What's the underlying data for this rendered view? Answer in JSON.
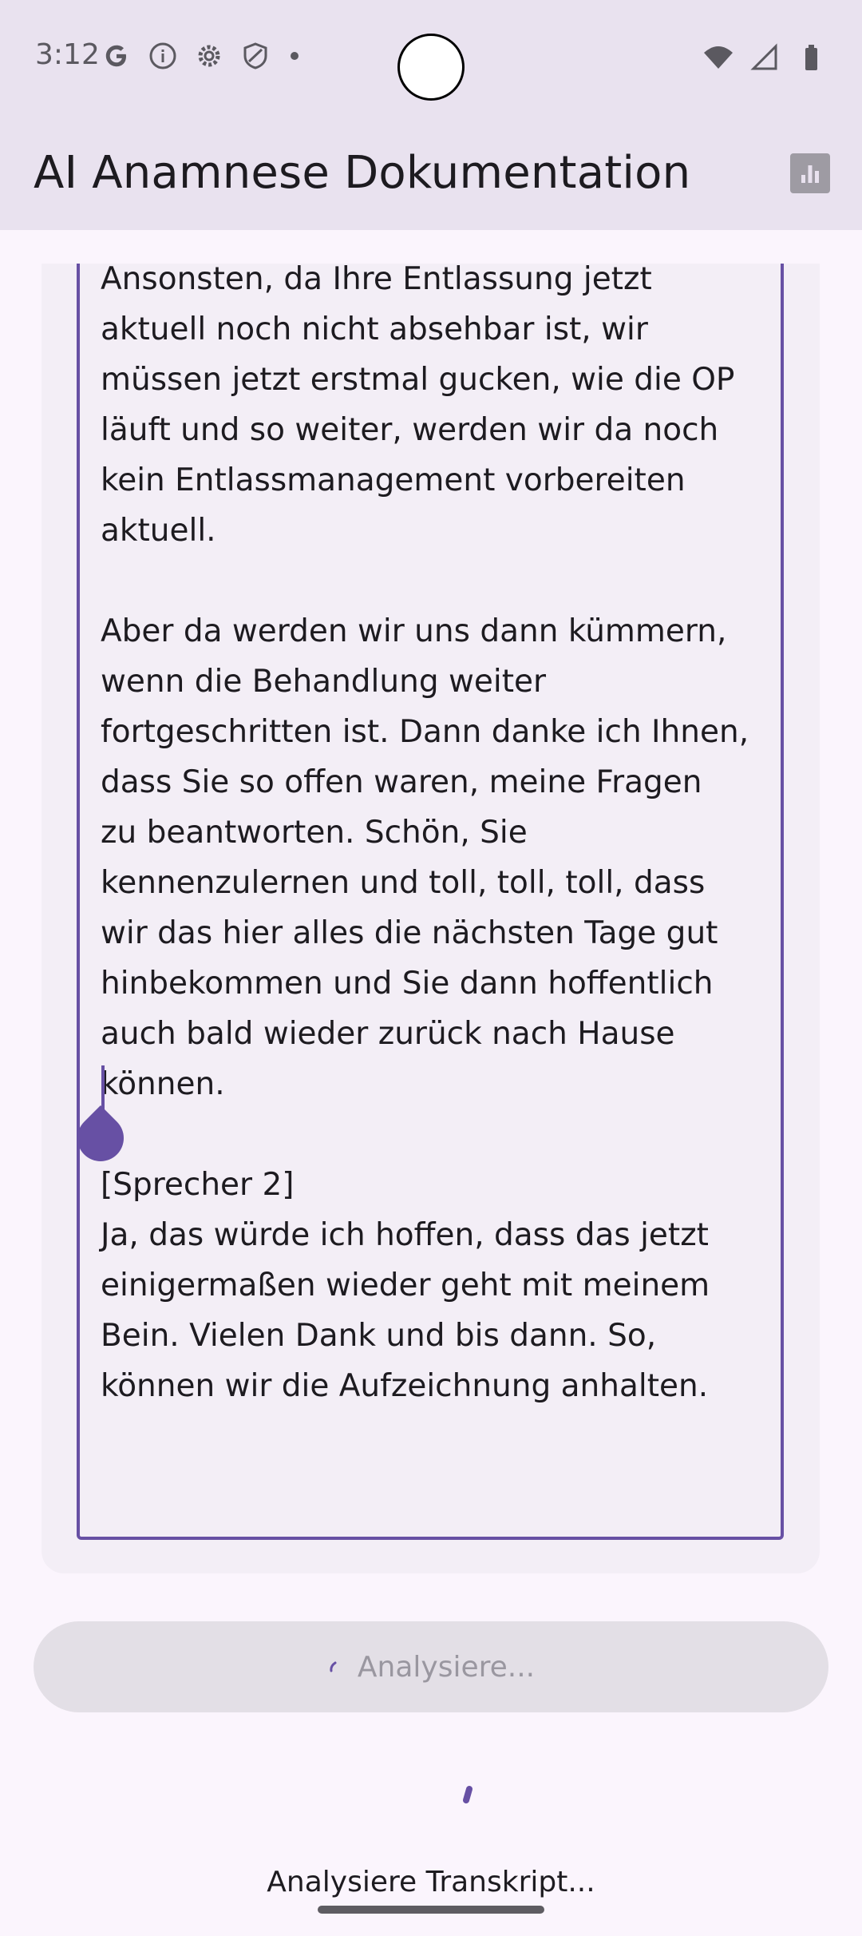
{
  "status_bar": {
    "time": "3:12",
    "icons_left": [
      "google-icon",
      "info-icon",
      "settings-icon",
      "shield-icon",
      "dot-icon"
    ],
    "icons_right": [
      "wifi-icon",
      "signal-icon",
      "battery-icon"
    ]
  },
  "app_bar": {
    "title": "AI Anamnese Dokumentation",
    "action_icon": "bar-chart-icon"
  },
  "transcript": {
    "text": "Ansonsten, da Ihre Entlassung jetzt\naktuell noch nicht absehbar ist, wir\nmüssen jetzt erstmal gucken, wie die OP\nläuft und so weiter, werden wir da noch\nkein Entlassmanagement vorbereiten\naktuell.\n\nAber da werden wir uns dann kümmern,\nwenn die Behandlung weiter\nfortgeschritten ist. Dann danke ich Ihnen,\ndass Sie so offen waren, meine Fragen\nzu beantworten. Schön, Sie\nkennenzulernen und toll, toll, toll, dass\nwir das hier alles die nächsten Tage gut\nhinbekommen und Sie dann hoffentlich\nauch bald wieder zurück nach Hause\nkönnen.\n\n[Sprecher 2]\nJa, das würde ich hoffen, dass das jetzt\neinigermaßen wieder geht mit meinem\nBein. Vielen Dank und bis dann. So,\nkönnen wir die Aufzeichnung anhalten."
  },
  "analyze_button": {
    "label": "Analysiere..."
  },
  "status": {
    "text": "Analysiere Transkript..."
  },
  "colors": {
    "accent": "#6750a4",
    "app_bar_bg": "#e9e2ef",
    "page_bg": "#fbf5fd"
  }
}
